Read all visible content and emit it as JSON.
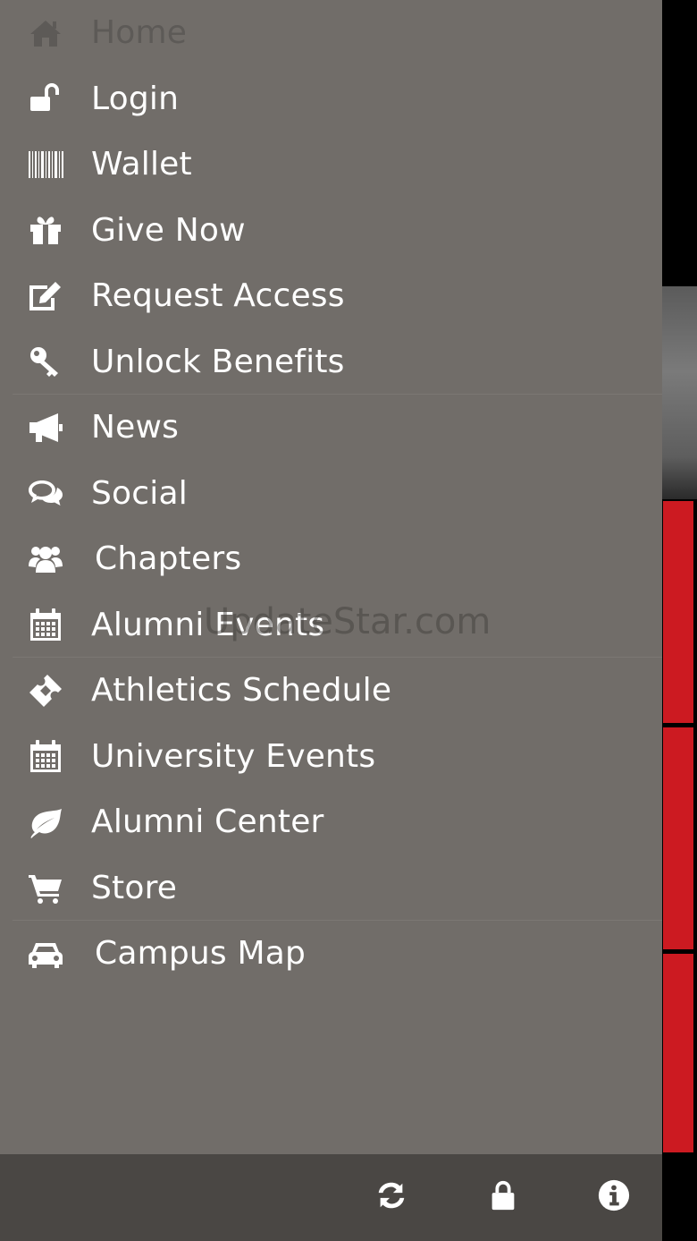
{
  "menu": {
    "items": [
      {
        "label": "Home",
        "icon": "home-icon",
        "dimmed": true
      },
      {
        "label": "Login",
        "icon": "unlock-icon"
      },
      {
        "label": "Wallet",
        "icon": "barcode-icon"
      },
      {
        "label": "Give Now",
        "icon": "gift-icon"
      },
      {
        "label": "Request Access",
        "icon": "edit-icon"
      },
      {
        "label": "Unlock Benefits",
        "icon": "key-icon"
      },
      {
        "label": "News",
        "icon": "megaphone-icon"
      },
      {
        "label": "Social",
        "icon": "comments-icon"
      },
      {
        "label": "Chapters",
        "icon": "users-icon"
      },
      {
        "label": "Alumni Events",
        "icon": "calendar-icon"
      },
      {
        "label": "Athletics Schedule",
        "icon": "ticket-icon"
      },
      {
        "label": "University Events",
        "icon": "calendar-icon"
      },
      {
        "label": "Alumni Center",
        "icon": "leaf-icon"
      },
      {
        "label": "Store",
        "icon": "cart-icon"
      },
      {
        "label": "Campus Map",
        "icon": "car-icon"
      }
    ]
  },
  "watermark": "UpdateStar.com",
  "toolbar": {
    "buttons": [
      {
        "icon": "refresh-icon"
      },
      {
        "icon": "lock-icon"
      },
      {
        "icon": "info-icon"
      }
    ]
  },
  "colors": {
    "drawer_bg": "#716d69",
    "toolbar_bg": "#4a4744",
    "accent_red": "#cc1a21",
    "text": "#ffffff",
    "dimmed_text": "#5d5a57"
  }
}
